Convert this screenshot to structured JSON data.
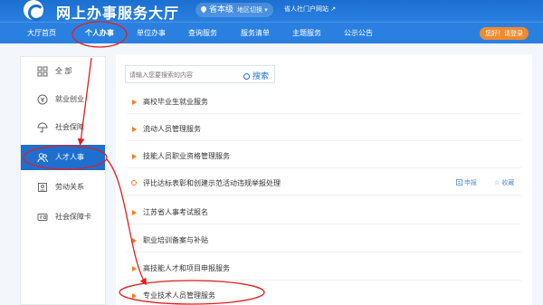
{
  "header": {
    "site_title": "网上办事服务大厅",
    "region": "省本级",
    "region_switch": "地区切换 ▾",
    "portal_link": "省人社门户网站 ↗"
  },
  "nav": {
    "items": [
      "大厅首页",
      "个人办事",
      "单位办事",
      "查询服务",
      "服务清单",
      "主题服务",
      "公示公告"
    ],
    "active": "个人办事",
    "login": "您好！请登录"
  },
  "sidebar": {
    "items": [
      {
        "label": "全 部",
        "icon": "grid-icon"
      },
      {
        "label": "就业创业",
        "icon": "coin-icon"
      },
      {
        "label": "社会保障",
        "icon": "umbrella-icon"
      },
      {
        "label": "人才人事",
        "icon": "people-icon"
      },
      {
        "label": "劳动关系",
        "icon": "form-icon"
      },
      {
        "label": "社会保障卡",
        "icon": "card-icon"
      }
    ],
    "active": "人才人事"
  },
  "search": {
    "placeholder": "请输入您要搜索的内容",
    "button": "搜索"
  },
  "services": [
    {
      "name": "高校毕业生就业服务"
    },
    {
      "name": "流动人员管理服务"
    },
    {
      "name": "技能人员职业资格管理服务"
    },
    {
      "name": "评比达标表彰和创建示范活动违规举报处理",
      "apply": "申报",
      "favorite": "收藏"
    },
    {
      "name": "江苏省人事考试报名"
    },
    {
      "name": "职业培训备案与补贴"
    },
    {
      "name": "高技能人才和项目申报服务"
    },
    {
      "name": "专业技术人员管理服务"
    }
  ],
  "colors": {
    "primary": "#1f6fcf",
    "nav_bg": "#2a80e0",
    "accent_orange": "#ff7a1a",
    "login_bg": "#f08a2e",
    "annotation_red": "#e02020"
  }
}
